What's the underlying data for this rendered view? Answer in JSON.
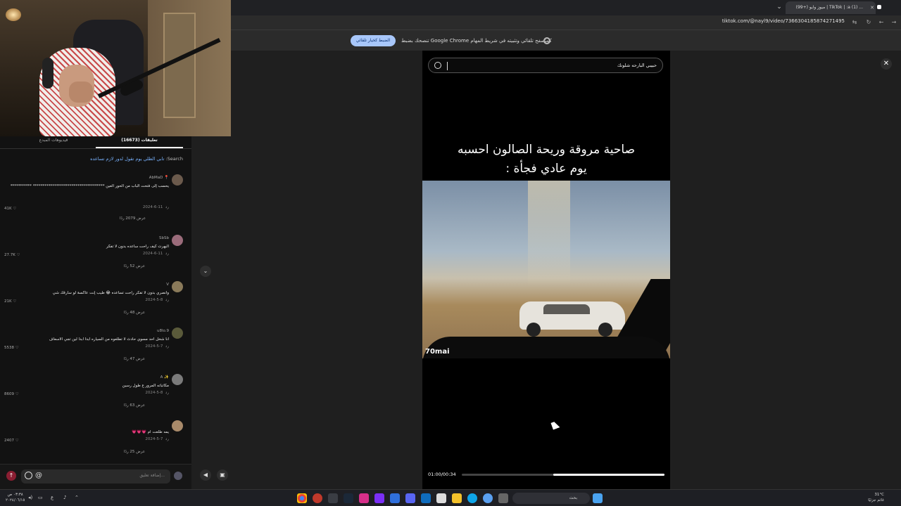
{
  "browser": {
    "tab_title": "(99+) ميوز وايو | TikTok | :a (1) ...",
    "tab_close": "✕",
    "new_tab": "+",
    "url": "tiktok.com/@nayl9/video/7366304185874271495",
    "infobar_text": "تنصحك بضبط Google Chrome كمتصفح تلقائي وتثبيته في شريط المهام",
    "infobar_button": "الضبط كخيار تلقائي"
  },
  "comments": {
    "tab_creator_videos": "فيديوهات المبدع",
    "tab_comments": "تعليقات (16673)",
    "search_prefix": "Search:",
    "search_query": "تابي الطلي يوم تقول لدور لازم تساعده",
    "items": [
      {
        "name": "AbMaD 📍",
        "text": "يحسب إلى فتحت الباب من الحور العين ************************************* ***********",
        "date": "2024-6-11",
        "reply": "رد",
        "replies": "عرض 2079 ردًا",
        "likes": "41K ♡"
      },
      {
        "name": "SbSb",
        "text": "البهرت كيف راحت ساعده بدون لا تفكر",
        "date": "2024-6-11",
        "reply": "رد",
        "replies": "عرض 52 ردًا",
        "likes": "27.7K ♡"
      },
      {
        "name": "V",
        "text": "وانصري بدون لا تفكر راحت تساعده 😂 طيب إنت عاكسة لو سارقك شي",
        "date": "2024-5-8",
        "reply": "رد",
        "replies": "عرض 48 ردًا",
        "likes": "21K ♡"
      },
      {
        "name": "u8lo.9",
        "text": "انا شخل احد مسوي حادث لا تطلعوه من السياره ابدا ابدا لين تجي الاسعاف",
        "date": "2024-5-7",
        "reply": "رد",
        "replies": "عرض 47 ردًا",
        "likes": "5538 ♡"
      },
      {
        "name": "A ✨",
        "text": "مكاتباته المرور ع طول رسين",
        "date": "2024-5-8",
        "reply": "رد",
        "replies": "عرض 63 ردًا",
        "likes": "8609 ♡"
      },
      {
        "name": "",
        "text": "يمه طلعت ام 💗💗💗",
        "date": "2024-5-7",
        "reply": "رد",
        "replies": "عرض 25 ردًا",
        "likes": "2407 ♡"
      }
    ],
    "input_placeholder": "إضافة تعليق...",
    "at_symbol": "@"
  },
  "video": {
    "search_value": "حبيبي البارحه شلونك",
    "caption_line1": "صاحية مروقة وريحة الصالون احسبه",
    "caption_line2": "يوم عادي فجأة :",
    "watermark": "70mai",
    "time": "01:00/00:34",
    "progress": 0.55,
    "close": "✕"
  },
  "taskbar": {
    "search_placeholder": "بحث",
    "weather_temp": "31°C",
    "weather_desc": "غائم جزئيًا",
    "time": "٠٣:٣٨ ص",
    "date": "٢٠٢٤/٠٦/١٥"
  },
  "colors": {
    "accent_blue": "#a8c7fa",
    "tiktok_red": "#8a1e32"
  }
}
